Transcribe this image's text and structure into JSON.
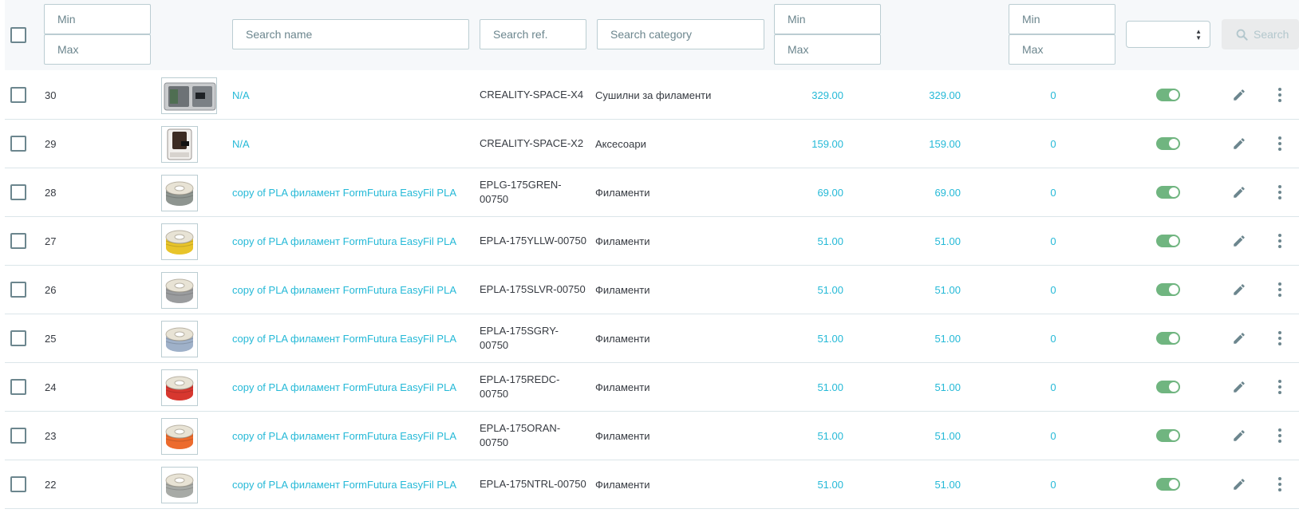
{
  "filters": {
    "id_min_placeholder": "Min",
    "id_max_placeholder": "Max",
    "name_placeholder": "Search name",
    "ref_placeholder": "Search ref.",
    "category_placeholder": "Search category",
    "price_min_placeholder": "Min",
    "price_max_placeholder": "Max",
    "qty_min_placeholder": "Min",
    "qty_max_placeholder": "Max",
    "status_value": "",
    "search_label": "Search"
  },
  "colors": {
    "link": "#25b9d7",
    "toggle_on": "#70b580",
    "border": "#bbcdd2"
  },
  "icons": [
    "pencil-icon",
    "more-vert-icon",
    "search-icon",
    "sort-icon"
  ],
  "products": [
    {
      "id": "30",
      "name": "N/A",
      "ref": "CREALITY-SPACE-X4",
      "category": "Сушилни за филаменти",
      "price_excl": "329.00",
      "price_incl": "329.00",
      "quantity": "0",
      "active": true,
      "thumb": "dryer-gray",
      "spool_color": ""
    },
    {
      "id": "29",
      "name": "N/A",
      "ref": "CREALITY-SPACE-X2",
      "category": "Аксесоари",
      "price_excl": "159.00",
      "price_incl": "159.00",
      "quantity": "0",
      "active": true,
      "thumb": "dryer-black",
      "spool_color": ""
    },
    {
      "id": "28",
      "name": "copy of PLA филамент FormFutura EasyFil PLA",
      "ref": "EPLG-175GREN-00750",
      "category": "Филаменти",
      "price_excl": "69.00",
      "price_incl": "69.00",
      "quantity": "0",
      "active": true,
      "thumb": "spool",
      "spool_color": "#8e9590"
    },
    {
      "id": "27",
      "name": "copy of PLA филамент FormFutura EasyFil PLA",
      "ref": "EPLA-175YLLW-00750",
      "category": "Филаменти",
      "price_excl": "51.00",
      "price_incl": "51.00",
      "quantity": "0",
      "active": true,
      "thumb": "spool",
      "spool_color": "#e8c42a"
    },
    {
      "id": "26",
      "name": "copy of PLA филамент FormFutura EasyFil PLA",
      "ref": "EPLA-175SLVR-00750",
      "category": "Филаменти",
      "price_excl": "51.00",
      "price_incl": "51.00",
      "quantity": "0",
      "active": true,
      "thumb": "spool",
      "spool_color": "#9a9c9e"
    },
    {
      "id": "25",
      "name": "copy of PLA филамент FormFutura EasyFil PLA",
      "ref": "EPLA-175SGRY-00750",
      "category": "Филаменти",
      "price_excl": "51.00",
      "price_incl": "51.00",
      "quantity": "0",
      "active": true,
      "thumb": "spool",
      "spool_color": "#9fb1c9"
    },
    {
      "id": "24",
      "name": "copy of PLA филамент FormFutura EasyFil PLA",
      "ref": "EPLA-175REDC-00750",
      "category": "Филаменти",
      "price_excl": "51.00",
      "price_incl": "51.00",
      "quantity": "0",
      "active": true,
      "thumb": "spool",
      "spool_color": "#d7372f"
    },
    {
      "id": "23",
      "name": "copy of PLA филамент FormFutura EasyFil PLA",
      "ref": "EPLA-175ORAN-00750",
      "category": "Филаменти",
      "price_excl": "51.00",
      "price_incl": "51.00",
      "quantity": "0",
      "active": true,
      "thumb": "spool",
      "spool_color": "#ec6b2d"
    },
    {
      "id": "22",
      "name": "copy of PLA филамент FormFutura EasyFil PLA",
      "ref": "EPLA-175NTRL-00750",
      "category": "Филаменти",
      "price_excl": "51.00",
      "price_incl": "51.00",
      "quantity": "0",
      "active": true,
      "thumb": "spool",
      "spool_color": "#a7aaa6"
    }
  ]
}
